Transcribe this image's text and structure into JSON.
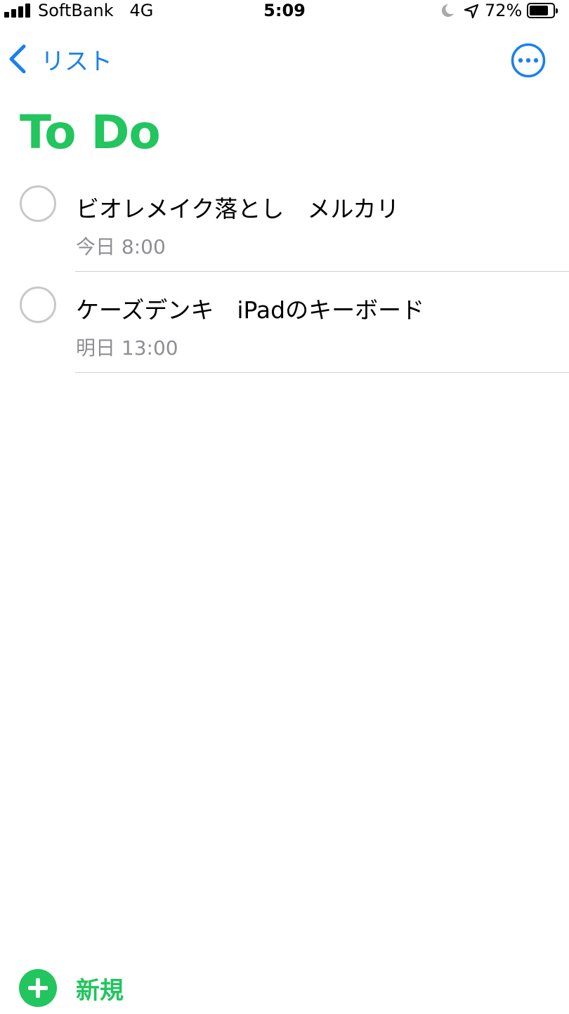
{
  "status_bar": {
    "carrier": "SoftBank   4G",
    "time": "5:09",
    "battery": "72%",
    "battery_level": 0.72,
    "icons": [
      "signal-icon",
      "moon-icon",
      "location-arrow-icon",
      "battery-icon"
    ]
  },
  "nav": {
    "back_label": "リスト",
    "back_icon": "chevron-left-icon",
    "more_icon": "ellipsis-circle-icon"
  },
  "list_title": "To Do",
  "reminders": [
    {
      "title": "ビオレメイク落とし　メルカリ",
      "due": "今日 8:00"
    },
    {
      "title": "ケーズデンキ　iPadのキーボード",
      "due": "明日 13:00"
    }
  ],
  "footer": {
    "new_label": "新規",
    "new_icon": "plus-circle-icon"
  },
  "colors": {
    "accent_green": "#22c55e",
    "link_blue": "#1a7ff0",
    "secondary_text": "#8e8e93",
    "separator": "#d1d1d6"
  }
}
